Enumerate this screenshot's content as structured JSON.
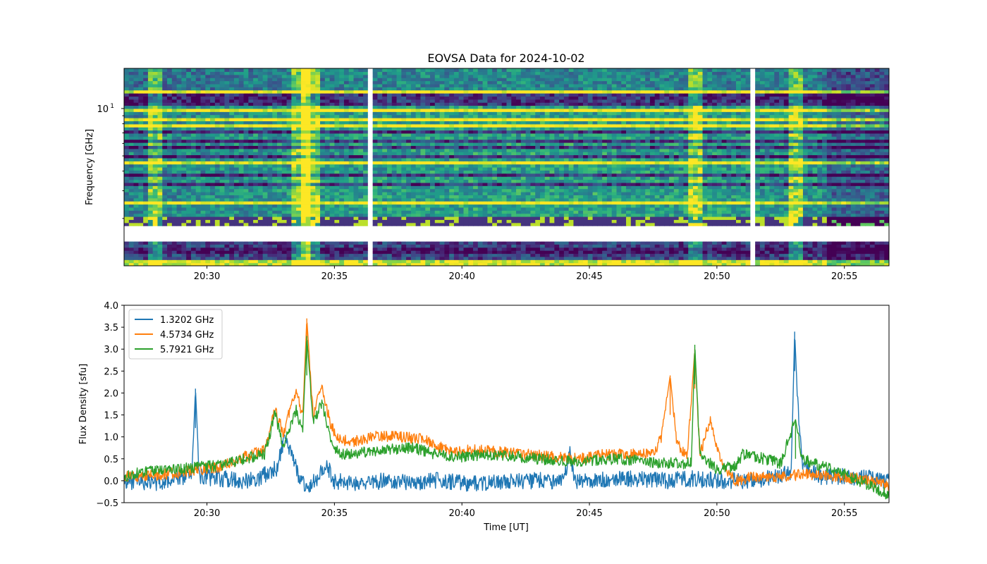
{
  "figure": {
    "title": "EOVSA Data for 2024-10-02"
  },
  "chart_data": [
    {
      "type": "heatmap",
      "title": "EOVSA Data for 2024-10-02",
      "xlabel": "",
      "ylabel": "Frequency [GHz]",
      "yscale": "log",
      "colormap": "viridis",
      "xlim": [
        "20:26:45",
        "20:56:45"
      ],
      "ylim_ghz": [
        1.0,
        18.0
      ],
      "x_ticks": [
        "20:30",
        "20:35",
        "20:40",
        "20:45",
        "20:50",
        "20:55"
      ],
      "y_tick_label": "10",
      "y_tick_exponent": "1",
      "y_tick_value": 10,
      "masked_band_ghz": [
        1.45,
        1.8
      ],
      "data_gaps_ut": [
        "20:36:25",
        "20:51:25"
      ],
      "bright_bands_ghz": [
        12.7,
        9.8,
        8.6,
        7.9,
        4.55,
        4.5,
        2.55,
        1.05
      ],
      "dark_bands_ghz": [
        12.0,
        11.4,
        10.6,
        7.1,
        6.3,
        5.6,
        4.9,
        3.8,
        3.3,
        1.25
      ],
      "burst_times_ut": [
        "20:33:40",
        "20:34:05",
        "20:49:10",
        "20:53:05",
        "20:28:00"
      ]
    },
    {
      "type": "line",
      "xlabel": "Time [UT]",
      "ylabel": "Flux Density [sfu]",
      "xlim": [
        "20:26:45",
        "20:56:45"
      ],
      "ylim": [
        -0.5,
        4.0
      ],
      "x_ticks": [
        "20:30",
        "20:35",
        "20:40",
        "20:45",
        "20:50",
        "20:55"
      ],
      "y_ticks": [
        "−0.5",
        "0.0",
        "0.5",
        "1.0",
        "1.5",
        "2.0",
        "2.5",
        "3.0",
        "3.5",
        "4.0"
      ],
      "legend_position": "upper-left",
      "series": [
        {
          "name": "1.3202 GHz",
          "color": "#1f77b4",
          "points": [
            [
              "20:26:45",
              0.0
            ],
            [
              "20:28:00",
              -0.05
            ],
            [
              "20:29:00",
              0.05
            ],
            [
              "20:29:25",
              0.2
            ],
            [
              "20:29:33",
              2.1
            ],
            [
              "20:29:42",
              0.1
            ],
            [
              "20:30:30",
              0.05
            ],
            [
              "20:31:30",
              0.0
            ],
            [
              "20:32:00",
              0.05
            ],
            [
              "20:32:45",
              0.3
            ],
            [
              "20:33:00",
              0.9
            ],
            [
              "20:33:20",
              0.6
            ],
            [
              "20:33:40",
              0.0
            ],
            [
              "20:34:00",
              -0.15
            ],
            [
              "20:34:30",
              0.2
            ],
            [
              "20:34:45",
              0.3
            ],
            [
              "20:35:00",
              0.0
            ],
            [
              "20:36:00",
              -0.05
            ],
            [
              "20:37:00",
              0.0
            ],
            [
              "20:38:00",
              -0.05
            ],
            [
              "20:39:00",
              0.0
            ],
            [
              "20:40:00",
              -0.05
            ],
            [
              "20:41:00",
              -0.05
            ],
            [
              "20:42:00",
              0.0
            ],
            [
              "20:43:00",
              0.0
            ],
            [
              "20:44:00",
              0.0
            ],
            [
              "20:44:15",
              0.7
            ],
            [
              "20:44:25",
              0.0
            ],
            [
              "20:45:00",
              0.0
            ],
            [
              "20:46:00",
              0.05
            ],
            [
              "20:47:00",
              0.05
            ],
            [
              "20:48:00",
              0.0
            ],
            [
              "20:49:00",
              0.05
            ],
            [
              "20:50:00",
              0.0
            ],
            [
              "20:51:00",
              0.0
            ],
            [
              "20:52:00",
              0.05
            ],
            [
              "20:52:55",
              0.2
            ],
            [
              "20:53:03",
              3.4
            ],
            [
              "20:53:10",
              1.8
            ],
            [
              "20:53:20",
              0.4
            ],
            [
              "20:54:00",
              0.1
            ],
            [
              "20:55:00",
              0.1
            ],
            [
              "20:56:00",
              0.05
            ],
            [
              "20:56:45",
              0.0
            ]
          ]
        },
        {
          "name": "4.5734 GHz",
          "color": "#ff7f0e",
          "points": [
            [
              "20:26:45",
              0.1
            ],
            [
              "20:27:30",
              0.1
            ],
            [
              "20:28:30",
              0.15
            ],
            [
              "20:29:30",
              0.25
            ],
            [
              "20:30:30",
              0.3
            ],
            [
              "20:31:30",
              0.55
            ],
            [
              "20:32:15",
              0.7
            ],
            [
              "20:32:40",
              1.6
            ],
            [
              "20:33:00",
              1.1
            ],
            [
              "20:33:30",
              2.1
            ],
            [
              "20:33:45",
              1.4
            ],
            [
              "20:33:55",
              3.7
            ],
            [
              "20:34:10",
              1.5
            ],
            [
              "20:34:30",
              2.2
            ],
            [
              "20:34:50",
              1.3
            ],
            [
              "20:35:10",
              0.95
            ],
            [
              "20:35:45",
              0.9
            ],
            [
              "20:36:30",
              1.0
            ],
            [
              "20:37:30",
              1.0
            ],
            [
              "20:38:30",
              0.95
            ],
            [
              "20:39:00",
              0.8
            ],
            [
              "20:39:40",
              0.65
            ],
            [
              "20:40:30",
              0.7
            ],
            [
              "20:41:30",
              0.65
            ],
            [
              "20:42:30",
              0.6
            ],
            [
              "20:43:30",
              0.55
            ],
            [
              "20:44:30",
              0.5
            ],
            [
              "20:45:30",
              0.6
            ],
            [
              "20:46:30",
              0.6
            ],
            [
              "20:47:30",
              0.6
            ],
            [
              "20:47:50",
              1.0
            ],
            [
              "20:48:10",
              2.4
            ],
            [
              "20:48:25",
              0.9
            ],
            [
              "20:48:50",
              0.5
            ],
            [
              "20:49:08",
              3.0
            ],
            [
              "20:49:20",
              0.6
            ],
            [
              "20:49:45",
              1.4
            ],
            [
              "20:50:00",
              0.8
            ],
            [
              "20:50:15",
              0.3
            ],
            [
              "20:50:45",
              0.0
            ],
            [
              "20:51:30",
              0.1
            ],
            [
              "20:52:30",
              0.1
            ],
            [
              "20:53:30",
              0.15
            ],
            [
              "20:54:30",
              0.1
            ],
            [
              "20:55:30",
              0.05
            ],
            [
              "20:56:45",
              -0.1
            ]
          ]
        },
        {
          "name": "5.7921 GHz",
          "color": "#2ca02c",
          "points": [
            [
              "20:26:45",
              0.1
            ],
            [
              "20:27:30",
              0.2
            ],
            [
              "20:28:30",
              0.25
            ],
            [
              "20:29:30",
              0.3
            ],
            [
              "20:30:30",
              0.35
            ],
            [
              "20:31:30",
              0.5
            ],
            [
              "20:32:15",
              0.6
            ],
            [
              "20:32:40",
              1.5
            ],
            [
              "20:33:00",
              0.8
            ],
            [
              "20:33:30",
              1.6
            ],
            [
              "20:33:45",
              1.1
            ],
            [
              "20:33:55",
              3.3
            ],
            [
              "20:34:10",
              1.3
            ],
            [
              "20:34:30",
              1.8
            ],
            [
              "20:34:50",
              1.0
            ],
            [
              "20:35:10",
              0.6
            ],
            [
              "20:36:00",
              0.65
            ],
            [
              "20:37:00",
              0.7
            ],
            [
              "20:38:00",
              0.75
            ],
            [
              "20:39:00",
              0.6
            ],
            [
              "20:40:00",
              0.55
            ],
            [
              "20:41:00",
              0.6
            ],
            [
              "20:42:00",
              0.55
            ],
            [
              "20:43:00",
              0.5
            ],
            [
              "20:44:00",
              0.45
            ],
            [
              "20:45:00",
              0.45
            ],
            [
              "20:46:00",
              0.5
            ],
            [
              "20:47:00",
              0.45
            ],
            [
              "20:48:00",
              0.4
            ],
            [
              "20:49:00",
              0.4
            ],
            [
              "20:49:08",
              3.1
            ],
            [
              "20:49:20",
              0.6
            ],
            [
              "20:50:00",
              0.25
            ],
            [
              "20:50:45",
              0.35
            ],
            [
              "20:51:00",
              0.6
            ],
            [
              "20:51:30",
              0.55
            ],
            [
              "20:52:30",
              0.4
            ],
            [
              "20:53:05",
              1.4
            ],
            [
              "20:53:20",
              0.5
            ],
            [
              "20:54:00",
              0.35
            ],
            [
              "20:55:00",
              0.15
            ],
            [
              "20:56:00",
              -0.1
            ],
            [
              "20:56:45",
              -0.35
            ]
          ]
        }
      ]
    }
  ]
}
